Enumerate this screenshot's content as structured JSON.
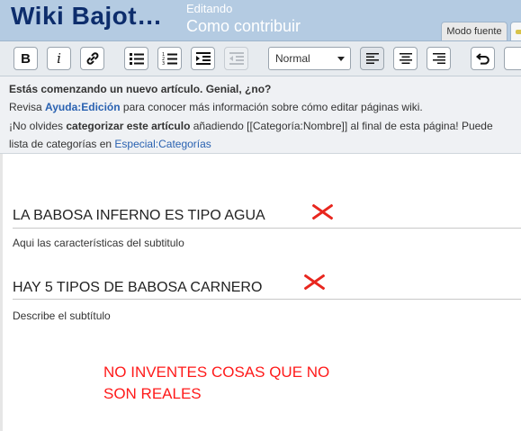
{
  "header": {
    "wiki_title": "Wiki Bajot…",
    "editing_label": "Editando",
    "page_name": "Como contribuir",
    "tabs": {
      "source_mode": "Modo fuente"
    }
  },
  "toolbar": {
    "bold": "B",
    "italic": "i",
    "format_select": "Normal",
    "icons": [
      "bold-icon",
      "italic-icon",
      "link-icon",
      "bulleted-list-icon",
      "numbered-list-icon",
      "indent-icon",
      "outdent-icon",
      "align-left-icon",
      "align-center-icon",
      "align-right-icon",
      "undo-icon"
    ]
  },
  "notice": {
    "line1": "Estás comenzando un nuevo artículo. Genial, ¿no?",
    "line2_pre": "Revisa ",
    "line2_link": "Ayuda:Edición",
    "line2_post": " para conocer más información sobre cómo editar páginas wiki.",
    "line3_pre": "¡No olvides ",
    "line3_bold": "categorizar este artículo",
    "line3_post": " añadiendo [[Categoría:Nombre]] al final de esta página! Puede",
    "line4_pre": "lista de categorías en ",
    "line4_link": "Especial:Categorías"
  },
  "editor": {
    "heading1": "LA BABOSA INFERNO ES TIPO AGUA",
    "para1": "Aqui las características del subtitulo",
    "heading2": "HAY 5 TIPOS DE BABOSA CARNERO",
    "para2": "Describe el subtítulo",
    "note_line1": "NO INVENTES COSAS QUE NO",
    "note_line2": "SON REALES"
  },
  "colors": {
    "header_bg": "#b4cbe2",
    "title": "#0d2d6c",
    "link": "#2a62b1",
    "annotation_red": "#ff1a1a"
  }
}
